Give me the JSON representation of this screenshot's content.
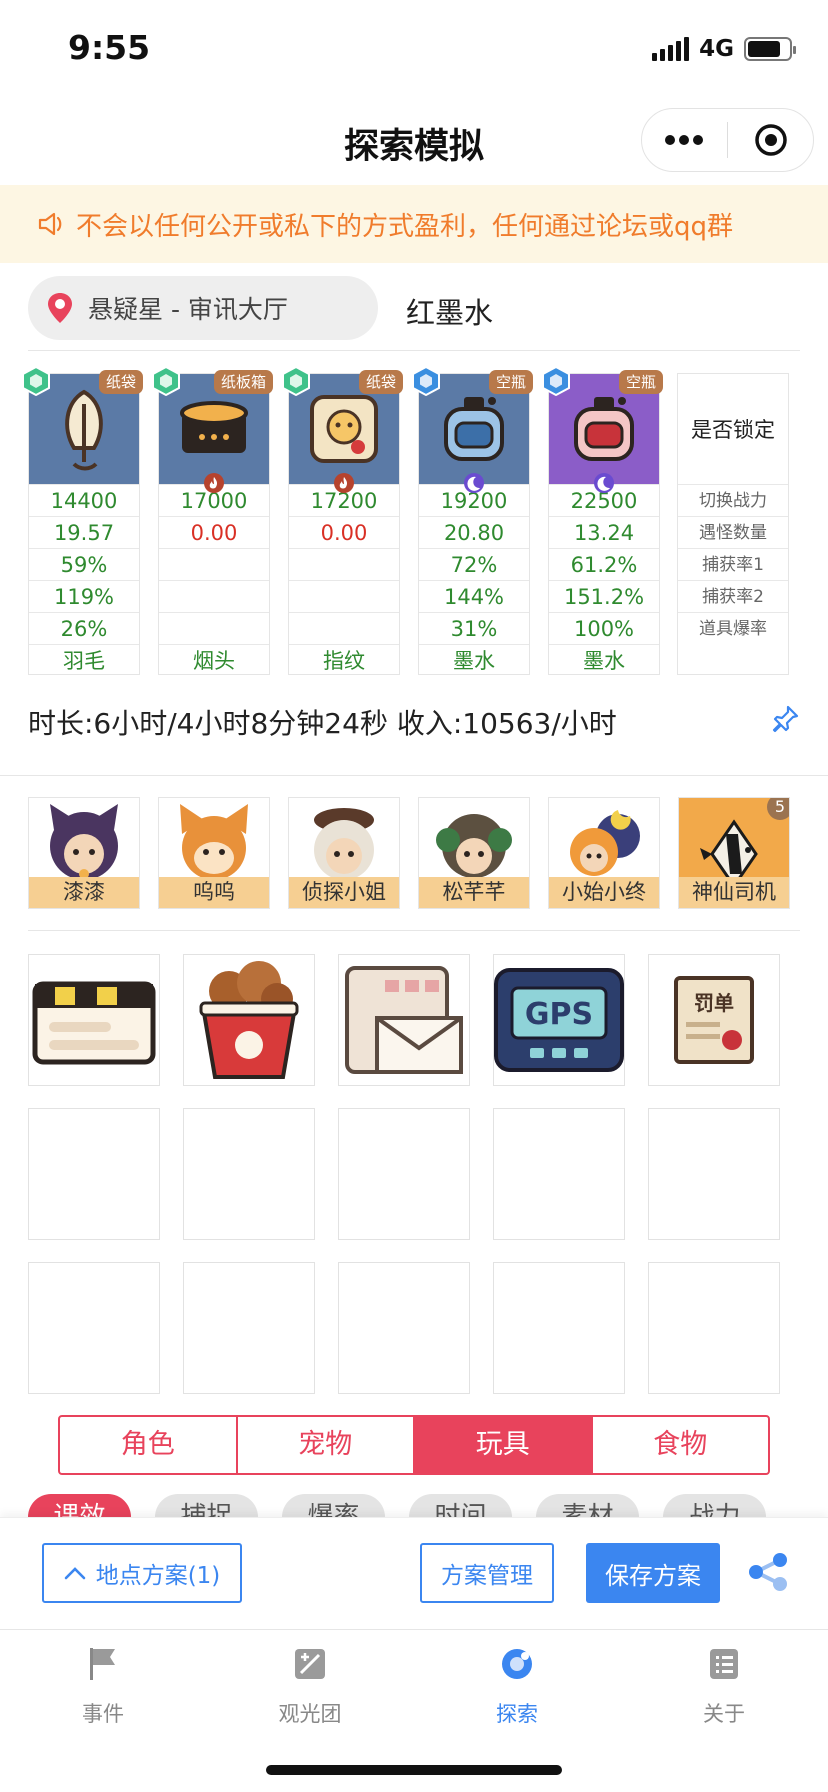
{
  "status_bar": {
    "time": "9:55",
    "network": "4G",
    "battery_level": 0.8
  },
  "header": {
    "title": "探索模拟"
  },
  "notice": {
    "text": "不会以任何公开或私下的方式盈利，任何通过论坛或qq群"
  },
  "location": {
    "place": "悬疑星 - 审讯大厅",
    "place_name": "红墨水"
  },
  "cards": [
    {
      "badge": "纸袋",
      "rows": [
        "14400",
        "19.57",
        "59%",
        "119%",
        "26%",
        "羽毛"
      ],
      "gem": "green"
    },
    {
      "badge": "纸板箱",
      "rows": [
        "17000",
        "0.00",
        "",
        "",
        "",
        "烟头"
      ],
      "gem": "green"
    },
    {
      "badge": "纸袋",
      "rows": [
        "17200",
        "0.00",
        "",
        "",
        "",
        "指纹"
      ],
      "gem": "green"
    },
    {
      "badge": "空瓶",
      "rows": [
        "19200",
        "20.80",
        "72%",
        "144%",
        "31%",
        "墨水"
      ],
      "gem": "blue"
    },
    {
      "badge": "空瓶",
      "rows": [
        "22500",
        "13.24",
        "61.2%",
        "151.2%",
        "100%",
        "墨水"
      ],
      "gem": "blue"
    }
  ],
  "legend": {
    "head": "是否锁定",
    "rows": [
      "切换战力",
      "遇怪数量",
      "捕获率1",
      "捕获率2",
      "道具爆率"
    ]
  },
  "summary": {
    "text": "时长:6小时/4小时8分钟24秒 收入:10563/小时"
  },
  "helpers": [
    {
      "label": "漆漆"
    },
    {
      "label": "呜呜"
    },
    {
      "label": "侦探小姐"
    },
    {
      "label": "松芊芊"
    },
    {
      "label": "小始小终"
    },
    {
      "label": "神仙司机",
      "count": "5"
    }
  ],
  "items": [
    {
      "name": "clapperboard"
    },
    {
      "name": "chicken-bucket"
    },
    {
      "name": "envelope"
    },
    {
      "name": "gps",
      "label": "GPS"
    },
    {
      "name": "ticket",
      "label": "罚单"
    }
  ],
  "tabs": [
    "角色",
    "宠物",
    "玩具",
    "食物"
  ],
  "chips": [
    "课效",
    "捕捉",
    "爆率",
    "时间",
    "素材",
    "战力"
  ],
  "actions": {
    "plan": "地点方案(1)",
    "manage": "方案管理",
    "save": "保存方案"
  },
  "tabbar": [
    "事件",
    "观光团",
    "探索",
    "关于"
  ],
  "colors": {
    "accent": "#e8435c",
    "primary": "#3b86f0",
    "notice": "#f07c2c",
    "gem_green": "#3fc28a",
    "gem_blue": "#3b8fe0"
  }
}
